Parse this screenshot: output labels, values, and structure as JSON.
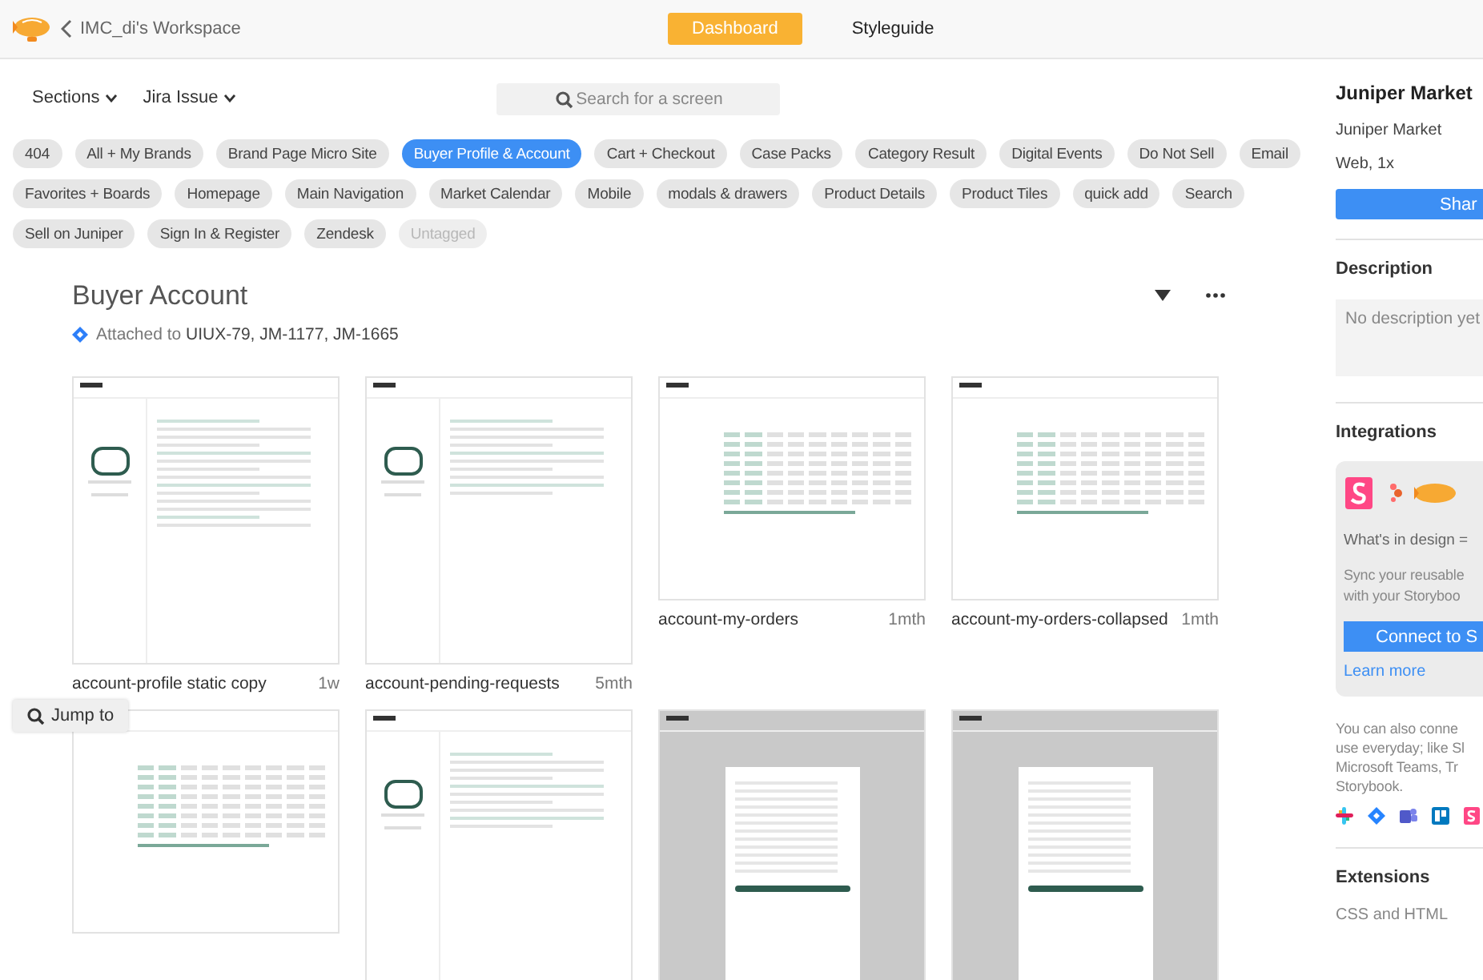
{
  "topbar": {
    "workspace": "IMC_di's Workspace",
    "tabs": [
      {
        "label": "Dashboard",
        "selected": true
      },
      {
        "label": "Styleguide",
        "selected": false
      }
    ]
  },
  "toolbar": {
    "filters": [
      "Sections",
      "Jira Issue"
    ],
    "search": {
      "placeholder": "Search for a screen"
    }
  },
  "tags": [
    {
      "label": "404",
      "selected": false,
      "disabled": false
    },
    {
      "label": "All + My Brands",
      "selected": false,
      "disabled": false
    },
    {
      "label": "Brand Page Micro Site",
      "selected": false,
      "disabled": false
    },
    {
      "label": "Buyer Profile & Account",
      "selected": true,
      "disabled": false
    },
    {
      "label": "Cart + Checkout",
      "selected": false,
      "disabled": false
    },
    {
      "label": "Case Packs",
      "selected": false,
      "disabled": false
    },
    {
      "label": "Category Result",
      "selected": false,
      "disabled": false
    },
    {
      "label": "Digital Events",
      "selected": false,
      "disabled": false
    },
    {
      "label": "Do Not Sell",
      "selected": false,
      "disabled": false
    },
    {
      "label": "Email",
      "selected": false,
      "disabled": false
    },
    {
      "label": "Favorites + Boards",
      "selected": false,
      "disabled": false
    },
    {
      "label": "Homepage",
      "selected": false,
      "disabled": false
    },
    {
      "label": "Main Navigation",
      "selected": false,
      "disabled": false
    },
    {
      "label": "Market Calendar",
      "selected": false,
      "disabled": false
    },
    {
      "label": "Mobile",
      "selected": false,
      "disabled": false
    },
    {
      "label": "modals & drawers",
      "selected": false,
      "disabled": false
    },
    {
      "label": "Product Details",
      "selected": false,
      "disabled": false
    },
    {
      "label": "Product Tiles",
      "selected": false,
      "disabled": false
    },
    {
      "label": "quick add",
      "selected": false,
      "disabled": false
    },
    {
      "label": "Search",
      "selected": false,
      "disabled": false
    },
    {
      "label": "Sell on Juniper",
      "selected": false,
      "disabled": false
    },
    {
      "label": "Sign In & Register",
      "selected": false,
      "disabled": false
    },
    {
      "label": "Zendesk",
      "selected": false,
      "disabled": false
    },
    {
      "label": "Untagged",
      "selected": false,
      "disabled": true
    }
  ],
  "section": {
    "title": "Buyer Account",
    "attached_label": "Attached to",
    "attached_issues": "UIUX-79, JM-1177, JM-1665"
  },
  "screens": [
    {
      "kind": "profile",
      "name": "account-profile static copy",
      "age": "1w"
    },
    {
      "kind": "list",
      "name": "account-pending-requests",
      "age": "5mth"
    },
    {
      "kind": "table",
      "name": "account-my-orders",
      "age": "1mth"
    },
    {
      "kind": "table",
      "name": "account-my-orders-collapsed",
      "age": "1mth"
    },
    {
      "kind": "table"
    },
    {
      "kind": "list"
    },
    {
      "kind": "modal"
    },
    {
      "kind": "modal"
    }
  ],
  "jump_button": "Jump to",
  "sidebar": {
    "project_title": "Juniper Market",
    "project_name": "Juniper Market",
    "platform": "Web, 1x",
    "share_button": "Shar",
    "description_heading": "Description",
    "description_placeholder": "No description yet",
    "integrations_heading": "Integrations",
    "promo": {
      "title": "What's in design =",
      "text_lines": [
        "Sync your reusable",
        "with your Storyboo"
      ],
      "button": "Connect to S",
      "link": "Learn more"
    },
    "also_lines": [
      "You can also conne",
      "use everyday; like Sl",
      "Microsoft Teams, Tr",
      "Storybook."
    ],
    "extensions_heading": "Extensions",
    "extension": "CSS and HTML"
  }
}
